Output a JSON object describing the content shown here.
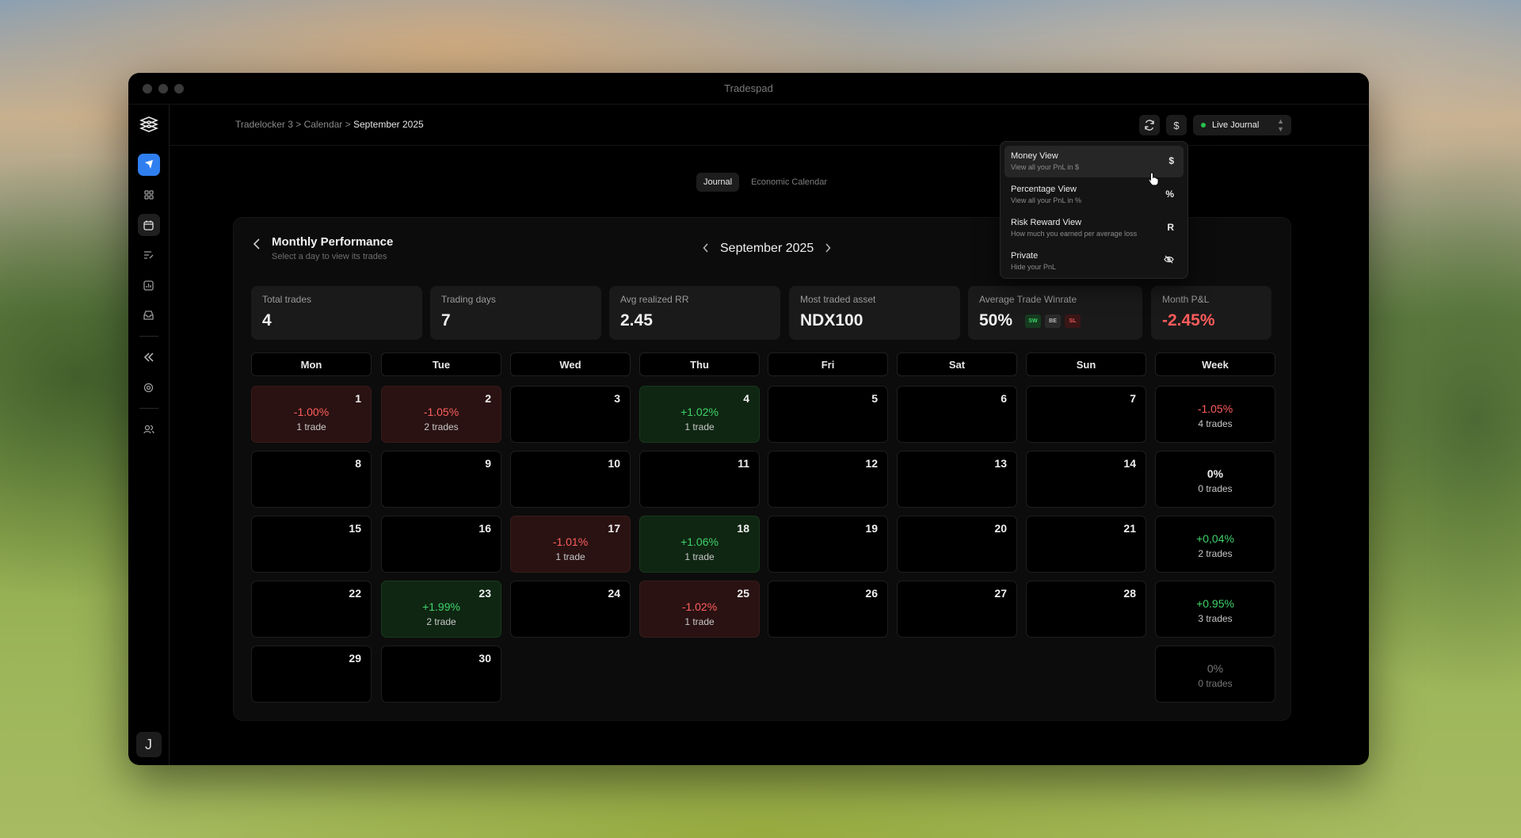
{
  "window": {
    "title": "Tradespad"
  },
  "breadcrumb": {
    "path": "Tradelocker 3 > Calendar > ",
    "current": "September 2025"
  },
  "topbar": {
    "sync_icon": "refresh-icon",
    "currency_label": "$",
    "journal_label": "Live Journal",
    "journal_status_color": "#27c24c"
  },
  "sidebar": {
    "items": [
      {
        "icon": "tradelocker-icon"
      },
      {
        "icon": "grid-icon"
      },
      {
        "icon": "calendar-icon"
      },
      {
        "icon": "notes-icon"
      },
      {
        "icon": "reports-icon"
      },
      {
        "icon": "inbox-icon"
      },
      {
        "icon": "collapse-icon"
      },
      {
        "icon": "target-icon"
      },
      {
        "icon": "users-icon"
      }
    ],
    "avatar_letter": "J"
  },
  "tabs": [
    {
      "label": "Journal",
      "active": true
    },
    {
      "label": "Economic Calendar",
      "active": false
    }
  ],
  "card": {
    "title": "Monthly Performance",
    "subtitle": "Select a day to view its trades",
    "month": "September 2025"
  },
  "stats": [
    {
      "label": "Total trades",
      "value": "4"
    },
    {
      "label": "Trading days",
      "value": "7"
    },
    {
      "label": "Avg realized RR",
      "value": "2.45"
    },
    {
      "label": "Most traded asset",
      "value": "NDX100"
    },
    {
      "label": "Average Trade Winrate",
      "value": "50%",
      "tags": [
        "SW",
        "BE",
        "SL"
      ]
    },
    {
      "label": "Month P&L",
      "value": "-2.45%"
    }
  ],
  "calendar": {
    "headers": [
      "Mon",
      "Tue",
      "Wed",
      "Thu",
      "Fri",
      "Sat",
      "Sun",
      "Week"
    ],
    "weeks": [
      {
        "days": [
          {
            "n": "1",
            "pnl": "-1.00%",
            "trades": "1 trade",
            "type": "loss"
          },
          {
            "n": "2",
            "pnl": "-1.05%",
            "trades": "2 trades",
            "type": "loss"
          },
          {
            "n": "3"
          },
          {
            "n": "4",
            "pnl": "+1.02%",
            "trades": "1 trade",
            "type": "win"
          },
          {
            "n": "5"
          },
          {
            "n": "6"
          },
          {
            "n": "7"
          }
        ],
        "week": {
          "pnl": "-1.05%",
          "trades": "4 trades",
          "type": "neg"
        }
      },
      {
        "days": [
          {
            "n": "8"
          },
          {
            "n": "9"
          },
          {
            "n": "10"
          },
          {
            "n": "11"
          },
          {
            "n": "12"
          },
          {
            "n": "13"
          },
          {
            "n": "14"
          }
        ],
        "week": {
          "pnl": "0%",
          "trades": "0 trades",
          "type": "zero"
        }
      },
      {
        "days": [
          {
            "n": "15"
          },
          {
            "n": "16"
          },
          {
            "n": "17",
            "pnl": "-1.01%",
            "trades": "1 trade",
            "type": "loss"
          },
          {
            "n": "18",
            "pnl": "+1.06%",
            "trades": "1 trade",
            "type": "win"
          },
          {
            "n": "19"
          },
          {
            "n": "20"
          },
          {
            "n": "21"
          }
        ],
        "week": {
          "pnl": "+0,04%",
          "trades": "2 trades",
          "type": "pos"
        }
      },
      {
        "days": [
          {
            "n": "22"
          },
          {
            "n": "23",
            "pnl": "+1.99%",
            "trades": "2 trade",
            "type": "win"
          },
          {
            "n": "24"
          },
          {
            "n": "25",
            "pnl": "-1.02%",
            "trades": "1 trade",
            "type": "loss"
          },
          {
            "n": "26"
          },
          {
            "n": "27"
          },
          {
            "n": "28"
          }
        ],
        "week": {
          "pnl": "+0.95%",
          "trades": "3 trades",
          "type": "pos"
        }
      },
      {
        "days": [
          {
            "n": "29"
          },
          {
            "n": "30"
          }
        ],
        "week": {
          "pnl": "0%",
          "trades": "0 trades",
          "type": "dim"
        }
      }
    ]
  },
  "view_menu": [
    {
      "title": "Money View",
      "desc": "View all your PnL in $",
      "key": "$",
      "active": true
    },
    {
      "title": "Percentage View",
      "desc": "View all your PnL in %",
      "key": "%",
      "active": false
    },
    {
      "title": "Risk Reward View",
      "desc": "How much you earned per average loss",
      "key": "R",
      "active": false
    },
    {
      "title": "Private",
      "desc": "Hide your PnL",
      "key": "eye-off-icon",
      "active": false
    }
  ]
}
